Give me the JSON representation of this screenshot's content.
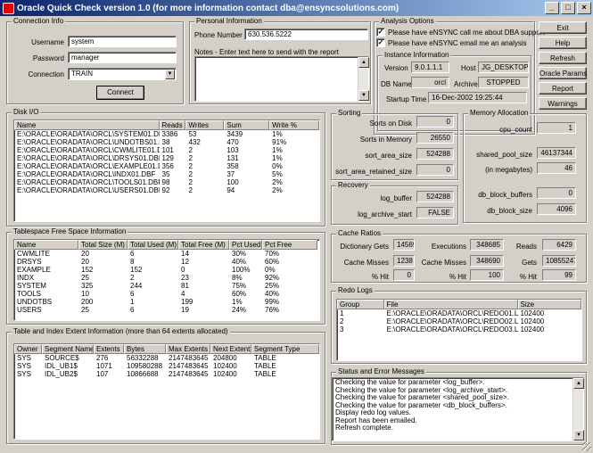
{
  "window": {
    "title": "Oracle Quick Check version 1.0 (for more information contact dba@ensyncsolutions.com)"
  },
  "connection": {
    "title": "Connection Info",
    "username_label": "Username",
    "username": "system",
    "password_label": "Password",
    "password": "manager",
    "connection_label": "Connection",
    "connection": "TRAIN",
    "connect_label": "Connect"
  },
  "personal": {
    "title": "Personal Information",
    "phone_label": "Phone Number",
    "phone": "630.536.5222",
    "notes_label": "Notes - Enter text here to send with the report"
  },
  "analysis": {
    "title": "Analysis Options",
    "opt1": "Please have eNSYNC call me about DBA support",
    "opt2": "Please have eNSYNC email me an analysis"
  },
  "instance": {
    "title": "Instance Information",
    "version_label": "Version",
    "version": "9.0.1.1.1",
    "host_label": "Host",
    "host": "JG_DESKTOP",
    "dbname_label": "DB Name",
    "dbname": "orcl",
    "archiver_label": "Archiver",
    "archiver": "STOPPED",
    "startup_label": "Startup Time",
    "startup": "16-Dec-2002 19:25:44"
  },
  "buttons": {
    "exit": "Exit",
    "help": "Help",
    "refresh": "Refresh",
    "params": "Oracle Params",
    "report": "Report",
    "warnings": "Warnings"
  },
  "diskio": {
    "title": "Disk I/O",
    "headers": [
      "Name",
      "Reads",
      "Writes",
      "Sum",
      "Write %"
    ],
    "rows": [
      [
        "E:\\ORACLE\\ORADATA\\ORCL\\SYSTEM01.DBF",
        "3386",
        "53",
        "3439",
        "1%"
      ],
      [
        "E:\\ORACLE\\ORADATA\\ORCL\\UNDOTBS01.DBF",
        "38",
        "432",
        "470",
        "91%"
      ],
      [
        "E:\\ORACLE\\ORADATA\\ORCL\\CWMLITE01.DBF",
        "101",
        "2",
        "103",
        "1%"
      ],
      [
        "E:\\ORACLE\\ORADATA\\ORCL\\DRSYS01.DBF",
        "129",
        "2",
        "131",
        "1%"
      ],
      [
        "E:\\ORACLE\\ORADATA\\ORCL\\EXAMPLE01.DBF",
        "356",
        "2",
        "358",
        "0%"
      ],
      [
        "E:\\ORACLE\\ORADATA\\ORCL\\INDX01.DBF",
        "35",
        "2",
        "37",
        "5%"
      ],
      [
        "E:\\ORACLE\\ORADATA\\ORCL\\TOOLS01.DBF",
        "98",
        "2",
        "100",
        "2%"
      ],
      [
        "E:\\ORACLE\\ORADATA\\ORCL\\USERS01.DBF",
        "92",
        "2",
        "94",
        "2%"
      ]
    ]
  },
  "sorting": {
    "title": "Sorting",
    "disk_label": "Sorts on Disk",
    "disk": "0",
    "mem_label": "Sorts in Memory",
    "mem": "26550",
    "area_label": "sort_area_size",
    "area": "524288",
    "retained_label": "sort_area_retained_size",
    "retained": "0"
  },
  "memory": {
    "title": "Memory Allocation",
    "cpu_label": "cpu_count",
    "cpu": "1",
    "pool_label": "shared_pool_size",
    "pool": "46137344",
    "mb_label": "(in megabytes)",
    "mb": "46",
    "buffers_label": "db_block_buffers",
    "buffers": "0",
    "blocksize_label": "db_block_size",
    "blocksize": "4096"
  },
  "recovery": {
    "title": "Recovery",
    "logbuf_label": "log_buffer",
    "logbuf": "524288",
    "archstart_label": "log_archive_start",
    "archstart": "FALSE"
  },
  "tablespace": {
    "title": "Tablespace Free Space Information",
    "headers": [
      "Name",
      "Total Size (M)",
      "Total Used (M)",
      "Total Free (M)",
      "Pct Used",
      "Pct Free"
    ],
    "rows": [
      [
        "CWMLITE",
        "20",
        "6",
        "14",
        "30%",
        "70%"
      ],
      [
        "DRSYS",
        "20",
        "8",
        "12",
        "40%",
        "60%"
      ],
      [
        "EXAMPLE",
        "152",
        "152",
        "0",
        "100%",
        "0%"
      ],
      [
        "INDX",
        "25",
        "2",
        "23",
        "8%",
        "92%"
      ],
      [
        "SYSTEM",
        "325",
        "244",
        "81",
        "75%",
        "25%"
      ],
      [
        "TOOLS",
        "10",
        "6",
        "4",
        "60%",
        "40%"
      ],
      [
        "UNDOTBS",
        "200",
        "1",
        "199",
        "1%",
        "99%"
      ],
      [
        "USERS",
        "25",
        "6",
        "19",
        "24%",
        "76%"
      ]
    ]
  },
  "cache": {
    "title": "Cache Ratios",
    "dict_label": "Dictionary Gets",
    "dict": "145697",
    "exec_label": "Executions",
    "exec": "348685",
    "reads_label": "Reads",
    "reads": "6429",
    "miss1_label": "Cache Misses",
    "miss1": "1238",
    "miss2_label": "Cache Misses",
    "miss2": "348690",
    "gets_label": "Gets",
    "gets": "10855247",
    "hit1_label": "% Hit",
    "hit1": "0",
    "hit2_label": "% Hit",
    "hit2": "100",
    "hit3_label": "% Hit",
    "hit3": "99"
  },
  "redo": {
    "title": "Redo Logs",
    "headers": [
      "Group",
      "File",
      "Size"
    ],
    "rows": [
      [
        "1",
        "E:\\ORACLE\\ORADATA\\ORCL\\REDO01.LOG",
        "102400"
      ],
      [
        "2",
        "E:\\ORACLE\\ORADATA\\ORCL\\REDO02.LOG",
        "102400"
      ],
      [
        "3",
        "E:\\ORACLE\\ORADATA\\ORCL\\REDO03.LOG",
        "102400"
      ]
    ]
  },
  "extents": {
    "title": "Table and Index Extent Information (more than 64 extents allocated)",
    "headers": [
      "Owner",
      "Segment Name",
      "Extents",
      "Bytes",
      "Max Extents",
      "Next Extent",
      "Segment Type"
    ],
    "rows": [
      [
        "SYS",
        "SOURCE$",
        "276",
        "56332288",
        "2147483645",
        "204800",
        "TABLE"
      ],
      [
        "SYS",
        "IDL_UB1$",
        "1071",
        "109580288",
        "2147483645",
        "102400",
        "TABLE"
      ],
      [
        "SYS",
        "IDL_UB2$",
        "107",
        "10866688",
        "2147483645",
        "102400",
        "TABLE"
      ]
    ]
  },
  "status": {
    "title": "Status and Error Messages",
    "messages": [
      "Checking the value for parameter <log_buffer>.",
      "Checking the value for parameter <log_archive_start>.",
      "Checking the value for parameter <shared_pool_size>.",
      "Checking the value for parameter <db_block_buffers>.",
      "Display redo log values.",
      "Report has been emailed.",
      "Refresh complete."
    ]
  }
}
